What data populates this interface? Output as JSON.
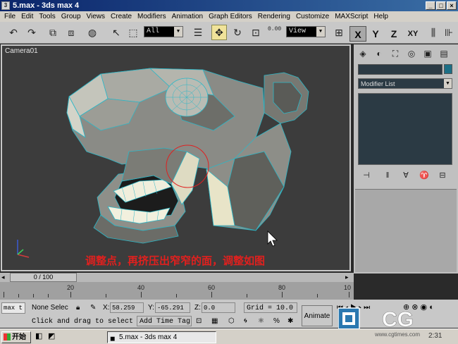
{
  "window": {
    "title": "5.max - 3ds max 4"
  },
  "menu": [
    "File",
    "Edit",
    "Tools",
    "Group",
    "Views",
    "Create",
    "Modifiers",
    "Animation",
    "Graph Editors",
    "Rendering",
    "Customize",
    "MAXScript",
    "Help"
  ],
  "toolbar": {
    "selection_filter": "All",
    "ref_coord": "View",
    "spinner_value": "0.00",
    "axes": [
      "X",
      "Y",
      "Z",
      "XY"
    ]
  },
  "viewport": {
    "label": "Camera01",
    "caption": "调整点，再挤压出窄窄的面，调整如图"
  },
  "command_panel": {
    "modifier_list": "Modifier List",
    "object_color": "#1c6f86"
  },
  "timeline": {
    "slider": "0 / 100",
    "ruler_labels": [
      "20",
      "40",
      "60",
      "80",
      "10"
    ]
  },
  "status": {
    "max_label": "max t",
    "selection": "None Selec",
    "x_label": "X:",
    "x_value": "58.259",
    "y_label": "Y:",
    "y_value": "-65.291",
    "z_label": "Z:",
    "z_value": "0.0",
    "grid": "Grid = 10.0",
    "prompt": "Click and drag to select",
    "add_time_tag": "Add Time Tag",
    "animate": "Animate"
  },
  "taskbar": {
    "start": "开始",
    "task": "5.max - 3ds max 4",
    "clock": "2:31"
  },
  "watermark": {
    "text": "CG",
    "url": "www.cgtimes.com"
  }
}
